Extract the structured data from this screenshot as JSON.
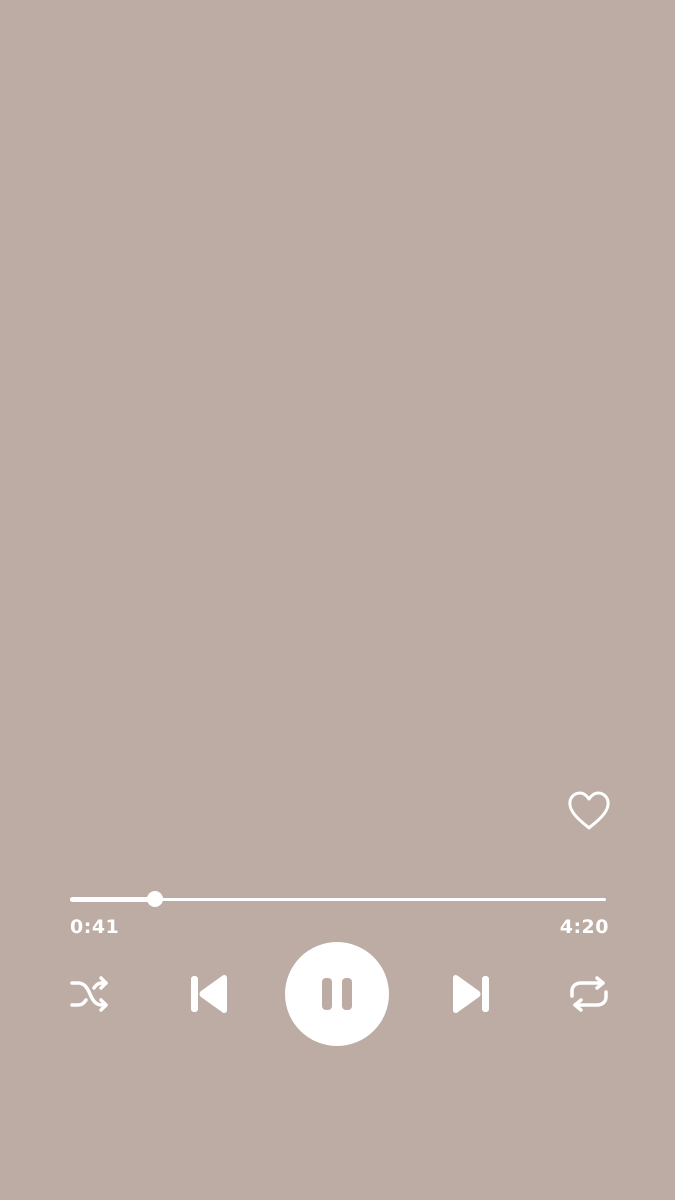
{
  "player": {
    "liked": false,
    "elapsed_time": "0:41",
    "total_time": "4:20",
    "progress_fraction": 0.158,
    "state": "playing",
    "accent_color": "#ffffff",
    "background_color": "#bcaca3"
  },
  "icons": {
    "like": "heart-outline-icon",
    "shuffle": "shuffle-icon",
    "previous": "skip-previous-icon",
    "pause": "pause-icon",
    "next": "skip-next-icon",
    "repeat": "repeat-icon"
  }
}
